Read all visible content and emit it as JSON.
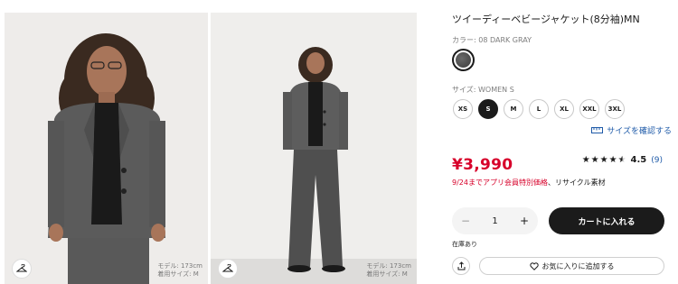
{
  "product": {
    "title": "ツイーディーベビージャケット(8分袖)MN",
    "color_label": "カラー: 08 DARK GRAY",
    "color_swatch": "#4a4a4a",
    "size_label": "サイズ: WOMEN S",
    "sizes": [
      "XS",
      "S",
      "M",
      "L",
      "XL",
      "XXL",
      "3XL"
    ],
    "selected_size": "S",
    "size_guide_link": "サイズを確認する",
    "price": "¥3,990",
    "rating": "4.5",
    "rating_count": "(9)",
    "stars_full": 4,
    "stars_half": 1,
    "promo_red": "9/24までアプリ会員特別価格",
    "promo_rest": "、リサイクル素材"
  },
  "cart": {
    "minus": "−",
    "quantity": "1",
    "plus": "+",
    "add_to_cart": "カートに入れる",
    "stock_status": "在庫あり",
    "favorite": "お気に入りに追加する"
  },
  "photos": [
    {
      "caption_line1": "モデル: 173cm",
      "caption_line2": "着用サイズ: M"
    },
    {
      "caption_line1": "モデル: 173cm",
      "caption_line2": "着用サイズ: M"
    }
  ],
  "colors": {
    "price_red": "#d7002a",
    "link_blue": "#1e5aa8",
    "dark": "#1b1b1b"
  }
}
